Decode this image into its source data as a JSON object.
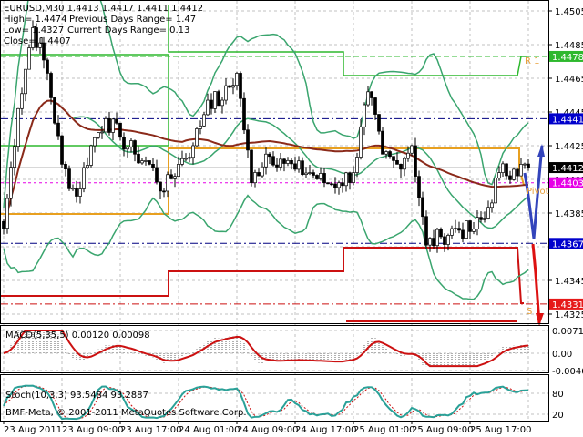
{
  "window": {
    "symbol_line": "EURUSD,M30  1.4413 1.4417 1.4411 1.4412"
  },
  "info": {
    "high": "High= 1.4474",
    "low": "Low= 1.4327",
    "close": "Close= 1.4407",
    "prev_range": "Previous Days Range= 1.47",
    "curr_range": "Current Days Range= 0.13"
  },
  "labels": {
    "r1": "R 1",
    "pivot": "Pivot",
    "s": "S"
  },
  "macd_label": "MACD(5,35,5) 0.00120 0.00098",
  "stoch_label": "Stoch(10,3,3) 93.5484 93.2887",
  "copyright": "BMF-Meta, © 2001-2011 MetaQuotes Software Corp.",
  "price_ticks": [
    "1.4505",
    "1.4485",
    "1.4465",
    "1.4445",
    "1.4425",
    "1.4405",
    "1.4385",
    "1.4345",
    "1.4325"
  ],
  "price_markers": [
    {
      "value": "1.4478",
      "color": "#2eb82e"
    },
    {
      "value": "1.4441",
      "color": "#0000cc"
    },
    {
      "value": "1.4412",
      "color": "#000000"
    },
    {
      "value": "1.4403",
      "color": "#e600e6"
    },
    {
      "value": "1.4367",
      "color": "#0000cc"
    },
    {
      "value": "1.4331",
      "color": "#e61919"
    }
  ],
  "macd_ticks": [
    "0.00711",
    "0.00",
    "-0.00403"
  ],
  "stoch_ticks": [
    "80",
    "20"
  ],
  "time_labels": [
    "23 Aug 2011",
    "23 Aug 09:00",
    "23 Aug 17:00",
    "24 Aug 01:00",
    "24 Aug 09:00",
    "24 Aug 17:00",
    "25 Aug 01:00",
    "25 Aug 09:00",
    "25 Aug 17:00"
  ],
  "chart_data": {
    "type": "candlestick",
    "symbol": "EURUSD",
    "timeframe": "M30",
    "ylim": [
      1.4318,
      1.4512
    ],
    "macd_ylim": [
      -0.00403,
      0.00711
    ],
    "stoch_ylim": [
      0,
      100
    ],
    "close_anchors_every_4_bars": [
      1.4376,
      1.4447,
      1.4495,
      1.4468,
      1.4414,
      1.4395,
      1.4425,
      1.4441,
      1.443,
      1.442,
      1.4414,
      1.4398,
      1.4414,
      1.4425,
      1.4452,
      1.4452,
      1.4468,
      1.4403,
      1.442,
      1.4417,
      1.4411,
      1.4409,
      1.4403,
      1.4403,
      1.4409,
      1.4457,
      1.442,
      1.4414,
      1.4425,
      1.4366,
      1.4371,
      1.4376,
      1.4374,
      1.4382,
      1.4409,
      1.4411,
      1.4412
    ],
    "levels": {
      "r1": 1.4478,
      "pivot": 1.4403,
      "s": 1.4331,
      "blue_upper": 1.4441,
      "blue_lower": 1.4367,
      "last": 1.4412
    },
    "colors": {
      "bands": "#3aa56e",
      "ma": "#8b2a1a",
      "macd_signal": "#cc1111",
      "macd_hist": "#b0b0b0",
      "stoch": "#2aa198",
      "grid": "#c0c0c0"
    }
  }
}
